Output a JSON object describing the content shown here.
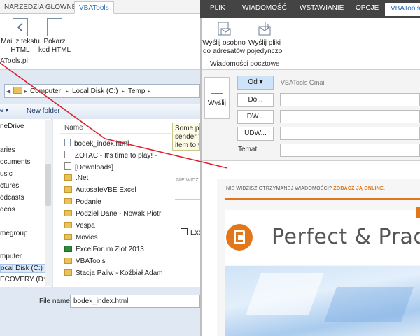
{
  "left_app": {
    "tabs": [
      {
        "label": "NARZĘDZIA GŁÓWNE"
      },
      {
        "label": "VBATools"
      }
    ],
    "ribbon_buttons": [
      {
        "label_line1": "Mail z tekstu",
        "label_line2": "HTML"
      },
      {
        "label_line1": "Pokarz",
        "label_line2": "kod HTML"
      }
    ],
    "ribbon_group_label": "ATools.pl"
  },
  "explorer": {
    "breadcrumb": [
      "Computer",
      "Local Disk (C:)",
      "Temp"
    ],
    "toolbar_caret": "e ▾",
    "new_folder_label": "New folder",
    "nav_items": [
      {
        "label": "neDrive"
      },
      {
        "label": "aries"
      },
      {
        "label": "ocuments"
      },
      {
        "label": "usic"
      },
      {
        "label": "ctures"
      },
      {
        "label": "odcasts"
      },
      {
        "label": "deos"
      },
      {
        "label": "megroup"
      },
      {
        "label": "mputer"
      },
      {
        "label": "ocal Disk (C:)"
      },
      {
        "label": "ECOVERY (D:)"
      }
    ],
    "column_name": "Name",
    "files": [
      {
        "name": "bodek_index.html",
        "kind": "doc"
      },
      {
        "name": "ZOTAC - It's time to play! - ",
        "kind": "sc"
      },
      {
        "name": "[Downloads]",
        "kind": "sc"
      },
      {
        "name": ".Net",
        "kind": "folder"
      },
      {
        "name": "AutosafeVBE Excel",
        "kind": "folder"
      },
      {
        "name": "Podanie",
        "kind": "folder"
      },
      {
        "name": "Podziel Dane - Nowak Piotr",
        "kind": "folder"
      },
      {
        "name": "Vespa",
        "kind": "folder"
      },
      {
        "name": "Movies",
        "kind": "folder"
      },
      {
        "name": "ExcelForum Zlot 2013",
        "kind": "xl"
      },
      {
        "name": "VBATools",
        "kind": "folder"
      },
      {
        "name": "Stacja Paliw - Koźbiał Adam",
        "kind": "folder"
      }
    ],
    "tooltip_lines": [
      "Some pi",
      "sender fr",
      "item to v"
    ],
    "preview_notice": "NIE WIDZI",
    "preview_excel": "Exc",
    "filename_label": "File name:",
    "filename_value": "bodek_index.html"
  },
  "outlook": {
    "tabs": [
      {
        "label": "PLIK"
      },
      {
        "label": "WIADOMOŚĆ"
      },
      {
        "label": "WSTAWIANIE"
      },
      {
        "label": "OPCJE"
      },
      {
        "label": "VBATools"
      }
    ],
    "ribbon_buttons": [
      {
        "label_line1": "Wyślij osobno",
        "label_line2": "do adresatów"
      },
      {
        "label_line1": "Wyślij pliki",
        "label_line2": "pojedynczo"
      }
    ],
    "ribbon_group_label": "Wiadomości pocztowe",
    "send_label": "Wyślij",
    "from_label": "Od ▾",
    "from_value": "VBATools Gmail",
    "to_label": "Do...",
    "cc_label": "DW...",
    "bcc_label": "UDW...",
    "subject_label": "Temat",
    "notice_text": "NIE WIDZISZ OTRZYMANEJ WIADOMOŚCI? ",
    "notice_link": "ZOBACZ JĄ ONLINE.",
    "newsletter_title": "Perfect & Pract"
  },
  "colors": {
    "accent_orange": "#e2761b",
    "outlook_tabbar": "#444444",
    "arrow_red": "#e0202a"
  }
}
